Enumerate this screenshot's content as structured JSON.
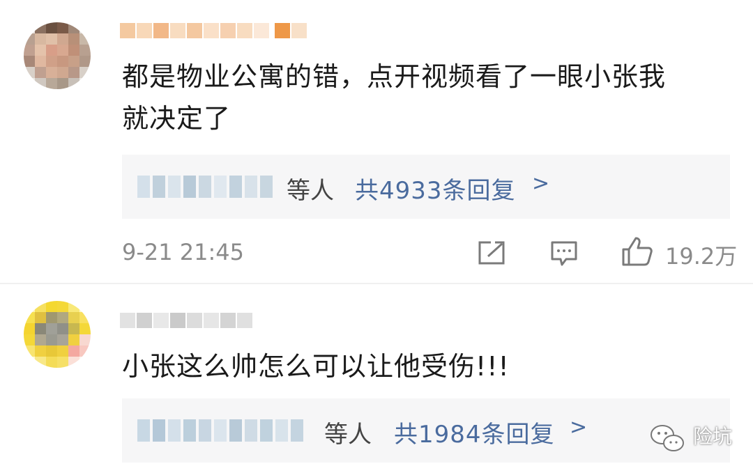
{
  "comments": [
    {
      "text_line1": "都是物业公寓的错，点开视频看了一眼小张我",
      "text_line2": "就决定了",
      "reply_others": "等人",
      "reply_count": "共4933条回复",
      "reply_chevron": ">",
      "time": "9-21 21:45",
      "like_count": "19.2万"
    },
    {
      "text_line1": "小张这么帅怎么可以让他受伤!!!",
      "reply_others": "等人",
      "reply_count": "共1984条回复",
      "reply_chevron": ">"
    }
  ],
  "watermark": {
    "text": "险坑",
    "icon": "wechat-icon"
  },
  "icons": {
    "share": "share-icon",
    "comment": "comment-icon",
    "like": "thumbs-up-icon"
  },
  "colors": {
    "link_blue": "#4a6b9e",
    "meta_gray": "#8a8a8a",
    "reply_bg": "#f6f6f7"
  }
}
